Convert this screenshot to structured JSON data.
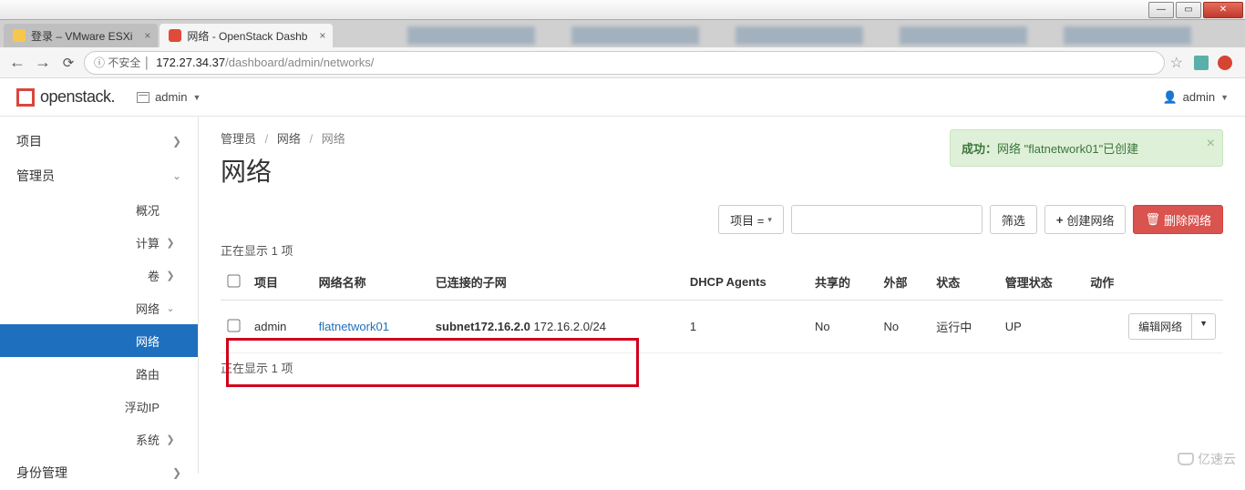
{
  "browser": {
    "tabs": [
      {
        "title": "登录 – VMware ESXi",
        "active": false
      },
      {
        "title": "网络 - OpenStack Dashb",
        "active": true
      }
    ],
    "url_host": "172.27.34.37",
    "url_path": "/dashboard/admin/networks/",
    "insecure_label": "不安全"
  },
  "window_buttons": {
    "min": "—",
    "max": "▭",
    "close": "✕"
  },
  "header": {
    "brand": "openstack.",
    "project": "admin",
    "user": "admin"
  },
  "sidebar": {
    "project": "项目",
    "admin": "管理员",
    "overview": "概况",
    "compute": "计算",
    "volume": "卷",
    "network": "网络",
    "network_sub": "网络",
    "routers": "路由",
    "floating_ip": "浮动IP",
    "system": "系统",
    "identity": "身份管理"
  },
  "breadcrumb": {
    "a": "管理员",
    "b": "网络",
    "c": "网络"
  },
  "page_title": "网络",
  "toast": {
    "prefix": "成功：",
    "msg": "网络 \"flatnetwork01\"已创建"
  },
  "toolbar": {
    "project_filter": "项目 =",
    "filter": "筛选",
    "create": "创建网络",
    "delete": "删除网络"
  },
  "table": {
    "showing_top": "正在显示 1 项",
    "showing_bottom": "正在显示 1 项",
    "headers": {
      "project": "项目",
      "name": "网络名称",
      "subnets": "已连接的子网",
      "dhcp": "DHCP Agents",
      "shared": "共享的",
      "external": "外部",
      "status": "状态",
      "admin_state": "管理状态",
      "actions": "动作"
    },
    "row": {
      "project": "admin",
      "name": "flatnetwork01",
      "subnet_name": "subnet172.16.2.0",
      "subnet_cidr": "172.16.2.0/24",
      "dhcp": "1",
      "shared": "No",
      "external": "No",
      "status": "运行中",
      "admin_state": "UP",
      "action": "编辑网络"
    }
  },
  "watermark": "亿速云"
}
